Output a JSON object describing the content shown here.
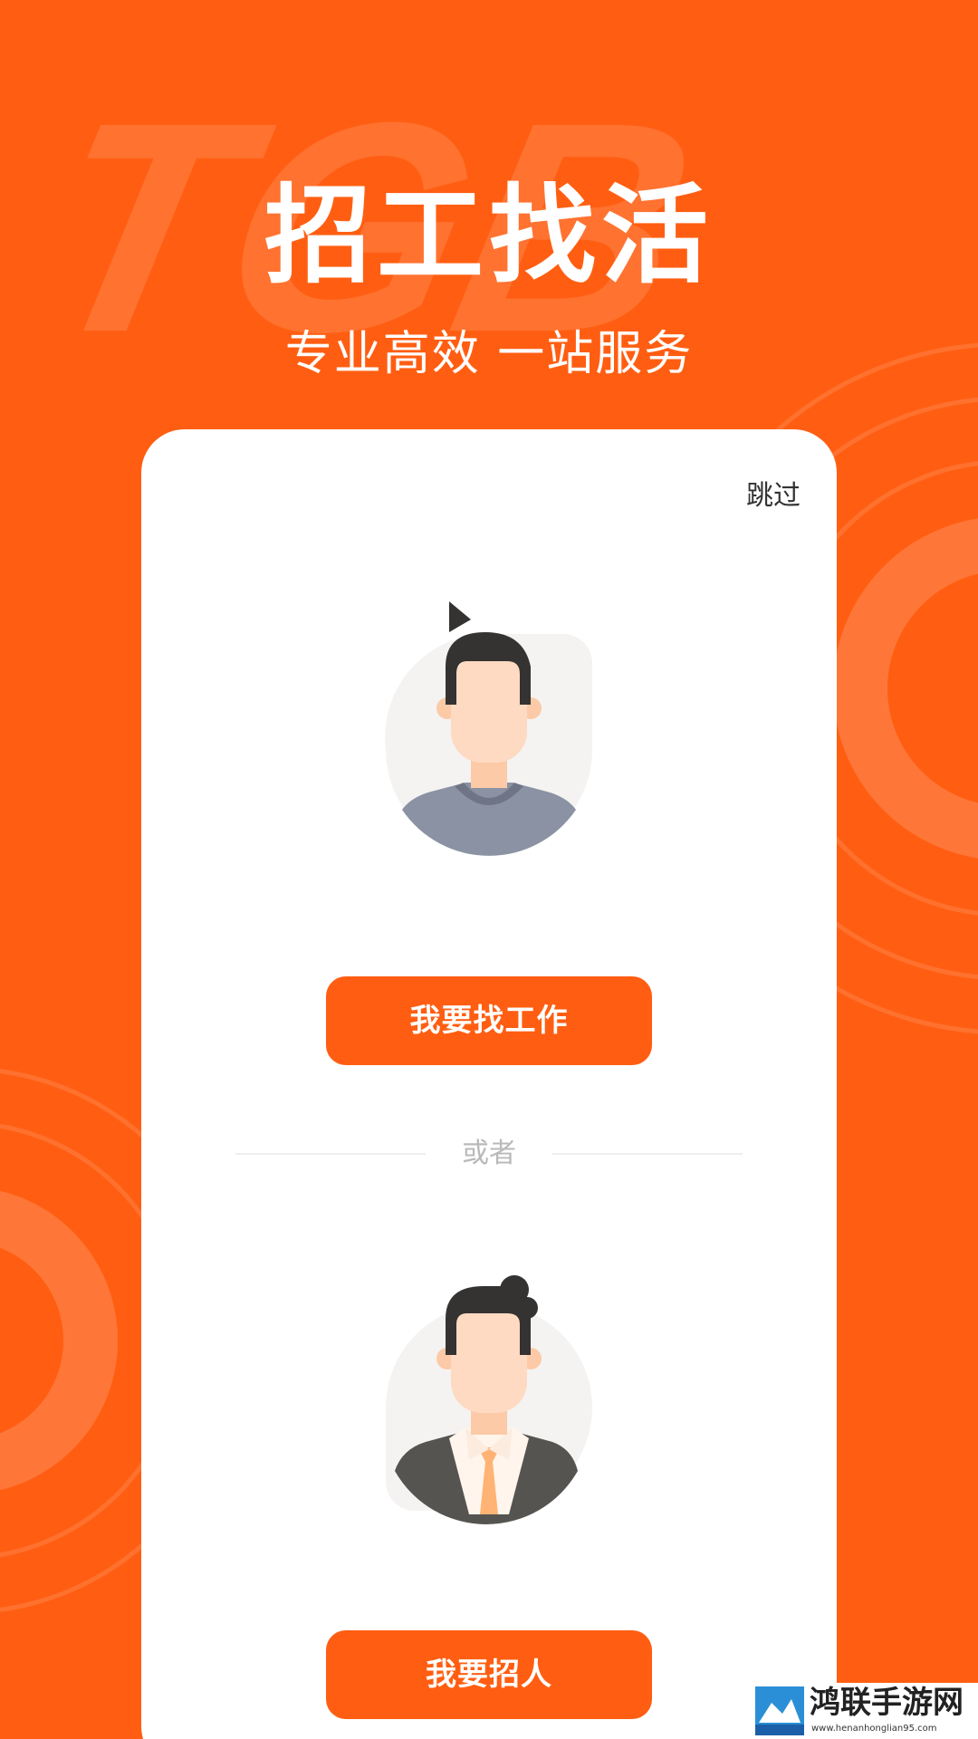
{
  "hero": {
    "title": "招工找活",
    "subtitle": "专业高效 一站服务",
    "background_text": "TGB"
  },
  "card": {
    "skip_label": "跳过",
    "find_job_button": "我要找工作",
    "divider_label": "或者",
    "hire_button": "我要招人"
  },
  "watermark": {
    "name": "鸿联手游网",
    "url": "www.henanhonglian95.com"
  },
  "colors": {
    "brand_orange": "#ff5e12",
    "card_background": "#ffffff",
    "divider_text": "#b9b9b9"
  },
  "icons": {
    "worker_avatar": "worker-avatar-icon",
    "employer_avatar": "employer-avatar-icon"
  }
}
